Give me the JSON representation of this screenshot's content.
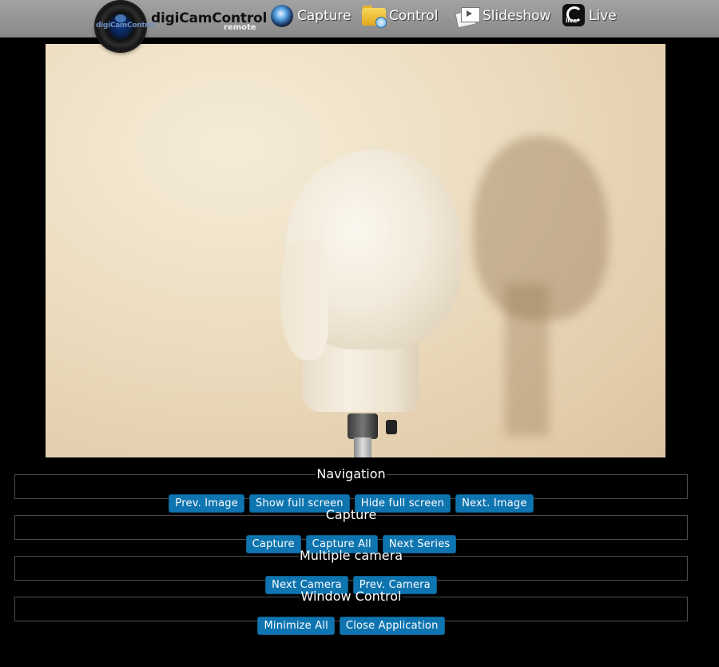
{
  "header": {
    "brand": "digiCamControl",
    "brand_sub": "remote",
    "logo_text": "digiCamControl",
    "nav": [
      {
        "label": "Capture",
        "icon": "capture-lens-icon"
      },
      {
        "label": "Control",
        "icon": "folder-control-icon"
      },
      {
        "label": "Slideshow",
        "icon": "slideshow-icon"
      },
      {
        "label": "Live",
        "icon": "live-icon"
      }
    ],
    "live_icon_text": "live"
  },
  "viewer": {
    "description_icon": "captured-photo"
  },
  "groups": {
    "navigation": {
      "title": "Navigation",
      "buttons": [
        "Prev. Image",
        "Show full screen",
        "Hide full screen",
        "Next. Image"
      ]
    },
    "capture": {
      "title": "Capture",
      "buttons": [
        "Capture",
        "Capture All",
        "Next Series"
      ]
    },
    "multiple_camera": {
      "title": "Multiple camera",
      "buttons": [
        "Next Camera",
        "Prev. Camera"
      ]
    },
    "window_control": {
      "title": "Window Control",
      "buttons": [
        "Minimize All",
        "Close Application"
      ]
    }
  },
  "colors": {
    "background": "#000000",
    "topbar": "#999999",
    "button": "#0f75b0",
    "button_text": "#ffffff"
  }
}
